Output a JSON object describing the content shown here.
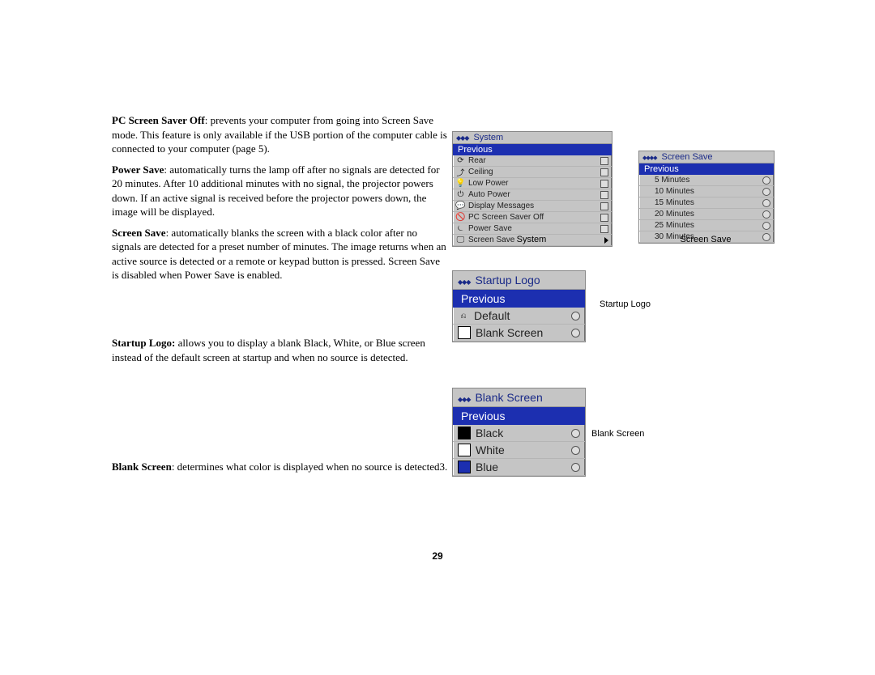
{
  "text": {
    "pcss_bold": "PC Screen Saver Off",
    "pcss_rest": ": prevents your computer from going into Screen Save mode. This feature is only available if the USB portion of the computer cable is connected to your computer (page 5).",
    "ps_bold": "Power Save",
    "ps_rest": ": automatically turns the lamp off after no signals are detected for 20 minutes. After 10 additional minutes with no signal, the projector powers down. If an active signal is received before the projector powers down, the image will be displayed.",
    "ss_bold": "Screen Save",
    "ss_rest": ": automatically blanks the screen with a black color after no signals are detected for a preset number of minutes. The image returns when an active source is detected or a remote or keypad button is pressed. Screen Save is disabled when Power Save is enabled.",
    "sl_bold": "Startup Logo:",
    "sl_rest": " allows you to display a blank Black, White, or Blue screen instead of the default screen at startup and when no source is detected.",
    "bs_bold": "Blank Screen",
    "bs_rest": ": determines what color is displayed when no source is detected3."
  },
  "labels": {
    "system": "System",
    "screen_save": "Screen Save",
    "startup_logo": "Startup Logo",
    "blank_screen": "Blank Screen"
  },
  "menus": {
    "system": {
      "title": "System",
      "hi": "Previous",
      "items": [
        "Rear",
        "Ceiling",
        "Low Power",
        "Auto Power",
        "Display Messages",
        "PC Screen Saver Off",
        "Power Save",
        "Screen Save"
      ]
    },
    "screensave": {
      "title": "Screen Save",
      "hi": "Previous",
      "items": [
        "5 Minutes",
        "10 Minutes",
        "15 Minutes",
        "20 Minutes",
        "25 Minutes",
        "30 Minutes"
      ]
    },
    "startup": {
      "title": "Startup Logo",
      "hi": "Previous",
      "items": [
        "Default",
        "Blank Screen"
      ]
    },
    "blank": {
      "title": "Blank Screen",
      "hi": "Previous",
      "items": [
        "Black",
        "White",
        "Blue"
      ]
    }
  },
  "page_number": "29"
}
